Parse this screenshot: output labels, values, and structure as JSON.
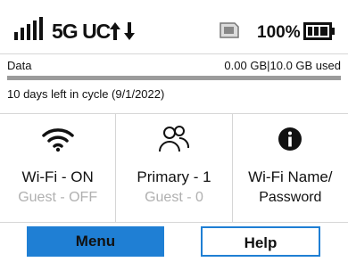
{
  "status": {
    "signal_icon": "signal-bars-icon",
    "network": "5G UC",
    "traffic_icon": "up-down-arrows-icon",
    "sim_icon": "sim-card-icon",
    "battery_percent": "100%",
    "battery_icon": "battery-full-icon"
  },
  "data": {
    "label": "Data",
    "used": "0.00 GB|10.0 GB used",
    "used_fraction": 0.0,
    "cycle": "10 days left in cycle (9/1/2022)"
  },
  "tiles": [
    {
      "icon": "wifi-icon",
      "main": "Wi-Fi - ON",
      "sub": "Guest - OFF"
    },
    {
      "icon": "users-icon",
      "main": "Primary - 1",
      "sub": "Guest - 0"
    },
    {
      "icon": "info-icon",
      "main": "Wi-Fi Name/",
      "sub": "Password"
    }
  ],
  "buttons": {
    "menu": "Menu",
    "help": "Help"
  },
  "colors": {
    "accent": "#1f7fd4",
    "bar_track": "#9b9b9b",
    "muted_text": "#b0b0b0"
  }
}
